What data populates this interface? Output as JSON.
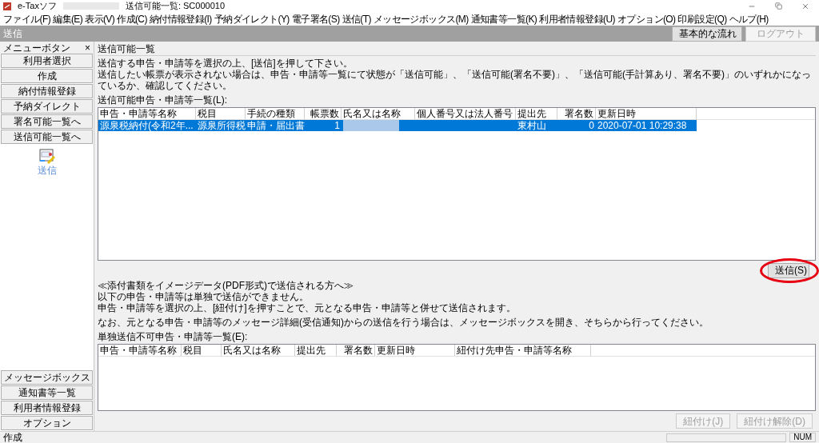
{
  "window": {
    "app": "e-Taxソフ",
    "title": "送信可能一覧: SC000010"
  },
  "menu": [
    "ファイル(F)",
    "編集(E)",
    "表示(V)",
    "作成(C)",
    "納付情報登録(I)",
    "予納ダイレクト(Y)",
    "電子署名(S)",
    "送信(T)",
    "メッセージボックス(M)",
    "通知書等一覧(K)",
    "利用者情報登録(U)",
    "オプション(O)",
    "印刷設定(Q)",
    "ヘルプ(H)"
  ],
  "header": {
    "title": "送信",
    "buttons": [
      {
        "label": "基本的な流れ",
        "disabled": false
      },
      {
        "label": "ログアウト",
        "disabled": true
      }
    ]
  },
  "sidebar": {
    "title": "メニューボタン",
    "close": "×",
    "items": [
      "利用者選択",
      "作成",
      "納付情報登録",
      "予納ダイレクト",
      "署名可能一覧へ",
      "送信可能一覧へ"
    ],
    "shortcut": "送信",
    "bottom_items": [
      "メッセージボックス",
      "通知書等一覧",
      "利用者情報登録",
      "オプション"
    ]
  },
  "page": {
    "title": "送信可能一覧",
    "instructions": [
      "送信する申告・申請等を選択の上、[送信]を押して下さい。",
      "送信したい帳票が表示されない場合は、申告・申請等一覧にて状態が「送信可能」、「送信可能(署名不要)」、「送信可能(手計算あり、署名不要)」のいずれかになっているか、確認してください。"
    ],
    "table_label": "送信可能申告・申請等一覧(L):",
    "table": {
      "columns": [
        {
          "label": "申告・申請等名称",
          "kind": "text"
        },
        {
          "label": "税目",
          "kind": "text"
        },
        {
          "label": "手続の種類",
          "kind": "text"
        },
        {
          "label": "帳票数",
          "kind": "number"
        },
        {
          "label": "氏名又は名称",
          "kind": "name"
        },
        {
          "label": "個人番号又は法人番号",
          "kind": "text"
        },
        {
          "label": "提出先",
          "kind": "text"
        },
        {
          "label": "署名数",
          "kind": "number"
        },
        {
          "label": "更新日時",
          "kind": "text"
        }
      ],
      "rows": [
        {
          "selected": true,
          "name_redacted": true,
          "cells": [
            "源泉税納付(令和2年...",
            "源泉所得税",
            "申請・届出書",
            "1",
            null,
            null,
            "東村山",
            "0",
            "2020-07-01 10:29:38"
          ]
        }
      ]
    },
    "send_button": {
      "label": "送信(S)",
      "highlighted": true
    },
    "notes": [
      "≪添付書類をイメージデータ(PDF形式)で送信される方へ≫",
      "以下の申告・申請等は単独で送信ができません。",
      "申告・申請等を選択の上、[紐付け]を押すことで、元となる申告・申請等と併せて送信されます。",
      "なお、元となる申告・申請等のメッセージ詳細(受信通知)からの送信を行う場合は、メッセージボックスを開き、そちらから行ってください。"
    ],
    "table2_label": "単独送信不可申告・申請等一覧(E):",
    "table2": {
      "columns": [
        "申告・申請等名称",
        "税目",
        "氏名又は名称",
        "提出先",
        "署名数",
        "更新日時",
        "紐付け先申告・申請等名称"
      ]
    },
    "buttons": [
      {
        "label": "紐付け(J)",
        "disabled": true
      },
      {
        "label": "紐付け解除(D)",
        "disabled": true
      }
    ]
  },
  "status_bar": {
    "text": "作成",
    "indicators": [
      "NUM"
    ]
  }
}
